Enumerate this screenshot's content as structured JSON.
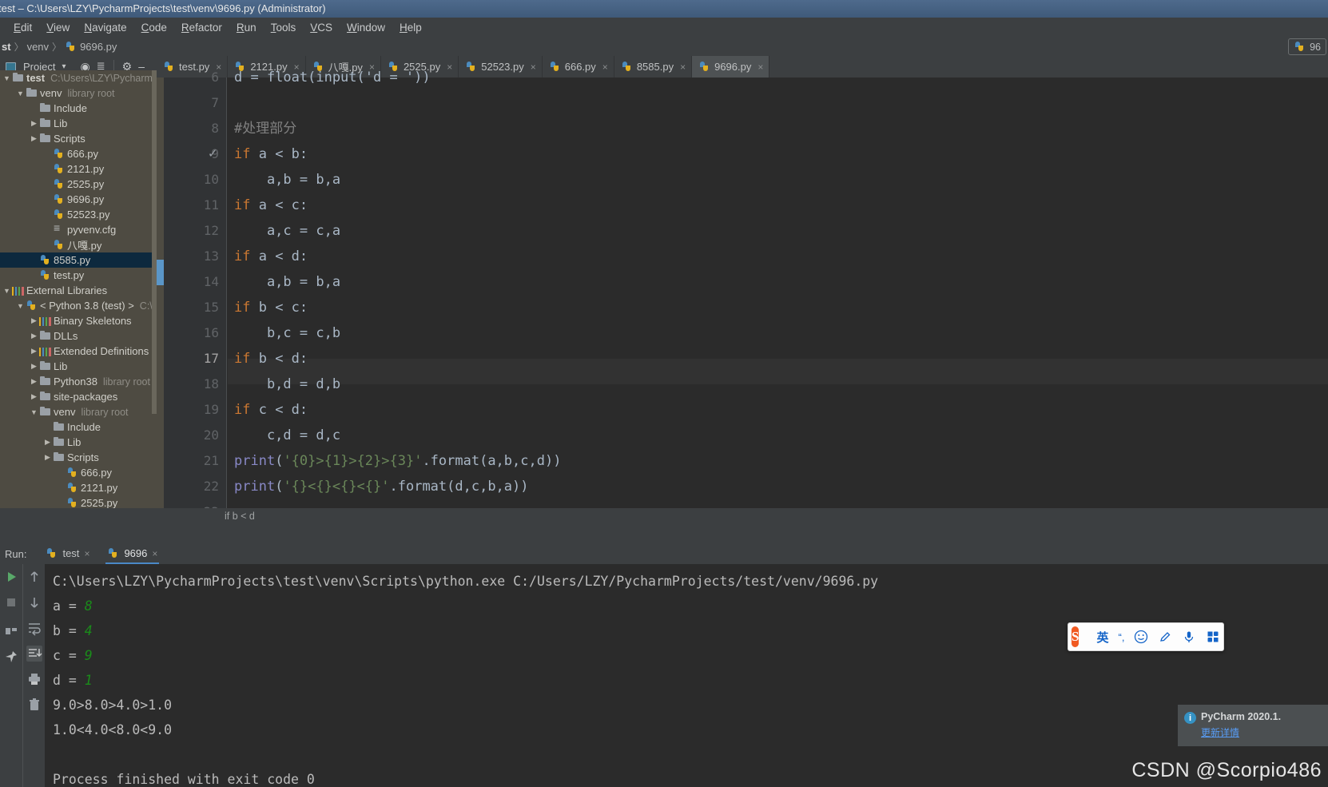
{
  "window": {
    "title": "test – C:\\Users\\LZY\\PycharmProjects\\test\\venv\\9696.py (Administrator)"
  },
  "menu": {
    "items": [
      "Edit",
      "View",
      "Navigate",
      "Code",
      "Refactor",
      "Run",
      "Tools",
      "VCS",
      "Window",
      "Help"
    ]
  },
  "navbar": {
    "crumb1": "st",
    "crumb2": "venv",
    "crumb3": "9696.py",
    "sep": "〉",
    "run_config": "96"
  },
  "project_panel": {
    "title": "Project",
    "chevron": "▾",
    "locate_icon": "target-icon",
    "collapse_icon": "collapse-all-icon",
    "settings_icon": "gear-icon",
    "hide_icon": "minimize-icon"
  },
  "tree": {
    "rows": [
      {
        "indent": 0,
        "twisty": "▼",
        "icon": "folder",
        "name": "test",
        "hint": "C:\\Users\\LZY\\PycharmPr",
        "bold": true,
        "selected": false
      },
      {
        "indent": 1,
        "twisty": "▼",
        "icon": "folder",
        "name": "venv",
        "hint": "library root",
        "bold": false,
        "selected": false
      },
      {
        "indent": 2,
        "twisty": "",
        "icon": "folder",
        "name": "Include",
        "hint": "",
        "bold": false,
        "selected": false
      },
      {
        "indent": 2,
        "twisty": "▶",
        "icon": "folder",
        "name": "Lib",
        "hint": "",
        "bold": false,
        "selected": false
      },
      {
        "indent": 2,
        "twisty": "▶",
        "icon": "folder",
        "name": "Scripts",
        "hint": "",
        "bold": false,
        "selected": false
      },
      {
        "indent": 3,
        "twisty": "",
        "icon": "py",
        "name": "666.py",
        "hint": "",
        "bold": false,
        "selected": false
      },
      {
        "indent": 3,
        "twisty": "",
        "icon": "py",
        "name": "2121.py",
        "hint": "",
        "bold": false,
        "selected": false
      },
      {
        "indent": 3,
        "twisty": "",
        "icon": "py",
        "name": "2525.py",
        "hint": "",
        "bold": false,
        "selected": false
      },
      {
        "indent": 3,
        "twisty": "",
        "icon": "py",
        "name": "9696.py",
        "hint": "",
        "bold": false,
        "selected": false
      },
      {
        "indent": 3,
        "twisty": "",
        "icon": "py",
        "name": "52523.py",
        "hint": "",
        "bold": false,
        "selected": false
      },
      {
        "indent": 3,
        "twisty": "",
        "icon": "cfg",
        "name": "pyvenv.cfg",
        "hint": "",
        "bold": false,
        "selected": false
      },
      {
        "indent": 3,
        "twisty": "",
        "icon": "py",
        "name": "八嘎.py",
        "hint": "",
        "bold": false,
        "selected": false
      },
      {
        "indent": 2,
        "twisty": "",
        "icon": "py",
        "name": "8585.py",
        "hint": "",
        "bold": false,
        "selected": true
      },
      {
        "indent": 2,
        "twisty": "",
        "icon": "py",
        "name": "test.py",
        "hint": "",
        "bold": false,
        "selected": false
      },
      {
        "indent": 0,
        "twisty": "▼",
        "icon": "lib",
        "name": "External Libraries",
        "hint": "",
        "bold": false,
        "selected": false
      },
      {
        "indent": 1,
        "twisty": "▼",
        "icon": "py",
        "name": "< Python 3.8 (test) >",
        "hint": "C:\\U",
        "bold": false,
        "selected": false
      },
      {
        "indent": 2,
        "twisty": "▶",
        "icon": "lib",
        "name": "Binary Skeletons",
        "hint": "",
        "bold": false,
        "selected": false
      },
      {
        "indent": 2,
        "twisty": "▶",
        "icon": "folder",
        "name": "DLLs",
        "hint": "",
        "bold": false,
        "selected": false
      },
      {
        "indent": 2,
        "twisty": "▶",
        "icon": "lib",
        "name": "Extended Definitions",
        "hint": "",
        "bold": false,
        "selected": false
      },
      {
        "indent": 2,
        "twisty": "▶",
        "icon": "folder",
        "name": "Lib",
        "hint": "",
        "bold": false,
        "selected": false
      },
      {
        "indent": 2,
        "twisty": "▶",
        "icon": "folder",
        "name": "Python38",
        "hint": "library root",
        "bold": false,
        "selected": false
      },
      {
        "indent": 2,
        "twisty": "▶",
        "icon": "folder",
        "name": "site-packages",
        "hint": "",
        "bold": false,
        "selected": false
      },
      {
        "indent": 2,
        "twisty": "▼",
        "icon": "folder",
        "name": "venv",
        "hint": "library root",
        "bold": false,
        "selected": false
      },
      {
        "indent": 3,
        "twisty": "",
        "icon": "folder",
        "name": "Include",
        "hint": "",
        "bold": false,
        "selected": false
      },
      {
        "indent": 3,
        "twisty": "▶",
        "icon": "folder",
        "name": "Lib",
        "hint": "",
        "bold": false,
        "selected": false
      },
      {
        "indent": 3,
        "twisty": "▶",
        "icon": "folder",
        "name": "Scripts",
        "hint": "",
        "bold": false,
        "selected": false
      },
      {
        "indent": 4,
        "twisty": "",
        "icon": "py",
        "name": "666.py",
        "hint": "",
        "bold": false,
        "selected": false
      },
      {
        "indent": 4,
        "twisty": "",
        "icon": "py",
        "name": "2121.py",
        "hint": "",
        "bold": false,
        "selected": false
      },
      {
        "indent": 4,
        "twisty": "",
        "icon": "py",
        "name": "2525.py",
        "hint": "",
        "bold": false,
        "selected": false
      }
    ]
  },
  "editor_tabs": {
    "close_glyph": "×",
    "items": [
      {
        "label": "test.py",
        "active": false
      },
      {
        "label": "2121.py",
        "active": false
      },
      {
        "label": "八嘎.py",
        "active": false
      },
      {
        "label": "2525.py",
        "active": false
      },
      {
        "label": "52523.py",
        "active": false
      },
      {
        "label": "666.py",
        "active": false
      },
      {
        "label": "8585.py",
        "active": false
      },
      {
        "label": "9696.py",
        "active": true
      }
    ]
  },
  "editor": {
    "first_visible_line": 6,
    "current_line": 17,
    "checkmark_line": 9,
    "breadcrumb": "if b < d",
    "lines": [
      {
        "no": 6,
        "tokens": [
          {
            "t": "d = float(input('d = '))",
            "c": "plain"
          }
        ],
        "clipped": true
      },
      {
        "no": 7,
        "tokens": []
      },
      {
        "no": 8,
        "tokens": [
          {
            "t": "#处理部分",
            "c": "cmt"
          }
        ]
      },
      {
        "no": 9,
        "tokens": [
          {
            "t": "if",
            "c": "kw"
          },
          {
            "t": " a < b:",
            "c": "plain"
          }
        ]
      },
      {
        "no": 10,
        "tokens": [
          {
            "t": "    a,b = b,a",
            "c": "plain"
          }
        ]
      },
      {
        "no": 11,
        "tokens": [
          {
            "t": "if",
            "c": "kw"
          },
          {
            "t": " a < c:",
            "c": "plain"
          }
        ]
      },
      {
        "no": 12,
        "tokens": [
          {
            "t": "    a,c = c,a",
            "c": "plain"
          }
        ]
      },
      {
        "no": 13,
        "tokens": [
          {
            "t": "if",
            "c": "kw"
          },
          {
            "t": " a < d:",
            "c": "plain"
          }
        ]
      },
      {
        "no": 14,
        "tokens": [
          {
            "t": "    a,b = b,a",
            "c": "plain"
          }
        ]
      },
      {
        "no": 15,
        "tokens": [
          {
            "t": "if",
            "c": "kw"
          },
          {
            "t": " b < c:",
            "c": "plain"
          }
        ]
      },
      {
        "no": 16,
        "tokens": [
          {
            "t": "    b,c = c,b",
            "c": "plain"
          }
        ]
      },
      {
        "no": 17,
        "tokens": [
          {
            "t": "if",
            "c": "kw"
          },
          {
            "t": " b < d:",
            "c": "plain"
          }
        ]
      },
      {
        "no": 18,
        "tokens": [
          {
            "t": "    b,d = d,b",
            "c": "plain"
          }
        ]
      },
      {
        "no": 19,
        "tokens": [
          {
            "t": "if",
            "c": "kw"
          },
          {
            "t": " c < d:",
            "c": "plain"
          }
        ]
      },
      {
        "no": 20,
        "tokens": [
          {
            "t": "    c,d = d,c",
            "c": "plain"
          }
        ]
      },
      {
        "no": 21,
        "tokens": [
          {
            "t": "print",
            "c": "fn"
          },
          {
            "t": "(",
            "c": "plain"
          },
          {
            "t": "'{0}>{1}>{2}>{3}'",
            "c": "str"
          },
          {
            "t": ".format(a,b,c,d))",
            "c": "plain"
          }
        ]
      },
      {
        "no": 22,
        "tokens": [
          {
            "t": "print",
            "c": "fn"
          },
          {
            "t": "(",
            "c": "plain"
          },
          {
            "t": "'{}<{}<{}<{}'",
            "c": "str"
          },
          {
            "t": ".format(d,c,b,a))",
            "c": "plain"
          }
        ]
      },
      {
        "no": 23,
        "tokens": []
      }
    ]
  },
  "run_panel": {
    "label": "Run:",
    "close_glyph": "×",
    "tabs": [
      {
        "label": "test",
        "active": false
      },
      {
        "label": "9696",
        "active": true
      }
    ],
    "toolbar_left": [
      "run-icon",
      "stop-icon",
      "restore-layout-icon",
      "pin-tab-icon"
    ],
    "toolbar_right": [
      "up-arrow-icon",
      "down-arrow-icon",
      "soft-wrap-icon",
      "scroll-to-end-icon",
      "print-icon",
      "trash-icon"
    ],
    "console": [
      {
        "segments": [
          {
            "t": "C:\\Users\\LZY\\PycharmProjects\\test\\venv\\Scripts\\python.exe C:/Users/LZY/PycharmProjects/test/venv/9696.py",
            "c": "out"
          }
        ]
      },
      {
        "segments": [
          {
            "t": "a = ",
            "c": "out"
          },
          {
            "t": "8",
            "c": "in"
          }
        ]
      },
      {
        "segments": [
          {
            "t": "b = ",
            "c": "out"
          },
          {
            "t": "4",
            "c": "in"
          }
        ]
      },
      {
        "segments": [
          {
            "t": "c = ",
            "c": "out"
          },
          {
            "t": "9",
            "c": "in"
          }
        ]
      },
      {
        "segments": [
          {
            "t": "d = ",
            "c": "out"
          },
          {
            "t": "1",
            "c": "in"
          }
        ]
      },
      {
        "segments": [
          {
            "t": "9.0>8.0>4.0>1.0",
            "c": "out"
          }
        ]
      },
      {
        "segments": [
          {
            "t": "1.0<4.0<8.0<9.0",
            "c": "out"
          }
        ]
      },
      {
        "segments": [
          {
            "t": "",
            "c": "out"
          }
        ]
      },
      {
        "segments": [
          {
            "t": "Process finished with exit code 0",
            "c": "out"
          }
        ]
      }
    ]
  },
  "ime_toolbar": {
    "logo": "S",
    "mode": "英",
    "punct": "“,",
    "emoji_icon": "smiley-icon",
    "pen_icon": "handwriting-icon",
    "mic_icon": "microphone-icon",
    "apps_icon": "toolbox-icon"
  },
  "toast": {
    "title": "PyCharm 2020.1.",
    "link": "更新详情"
  },
  "watermark": "CSDN @Scorpio486",
  "colors": {
    "accent": "#4a88c7",
    "editor_bg": "#2b2b2b",
    "panel_bg": "#3c3f41",
    "tree_bg": "#4e4b42",
    "selection": "#0d293e",
    "keyword": "#cc7832",
    "string": "#6a8759",
    "function": "#8888c6",
    "comment": "#808080",
    "console_input": "#1a8c1a",
    "ime_brand": "#f15a22"
  }
}
